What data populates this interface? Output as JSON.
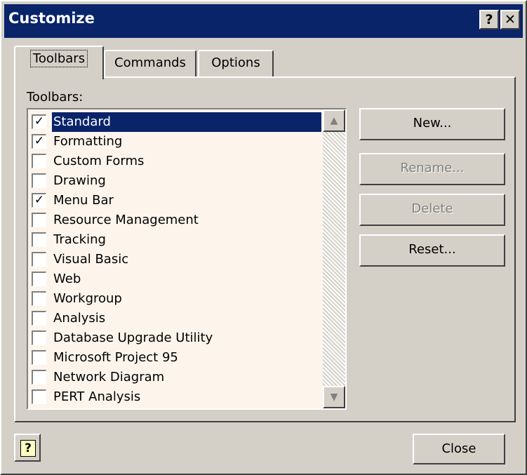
{
  "window": {
    "title": "Customize",
    "help_label": "?",
    "close_label": "✕"
  },
  "tabs": [
    {
      "label": "Toolbars",
      "active": true
    },
    {
      "label": "Commands",
      "active": false
    },
    {
      "label": "Options",
      "active": false
    }
  ],
  "toolbars_label": "Toolbars:",
  "toolbar_items": [
    {
      "label": "Standard",
      "checked": true,
      "selected": true
    },
    {
      "label": "Formatting",
      "checked": true,
      "selected": false
    },
    {
      "label": "Custom Forms",
      "checked": false,
      "selected": false
    },
    {
      "label": "Drawing",
      "checked": false,
      "selected": false
    },
    {
      "label": "Menu Bar",
      "checked": true,
      "selected": false
    },
    {
      "label": "Resource Management",
      "checked": false,
      "selected": false
    },
    {
      "label": "Tracking",
      "checked": false,
      "selected": false
    },
    {
      "label": "Visual Basic",
      "checked": false,
      "selected": false
    },
    {
      "label": "Web",
      "checked": false,
      "selected": false
    },
    {
      "label": "Workgroup",
      "checked": false,
      "selected": false
    },
    {
      "label": "Analysis",
      "checked": false,
      "selected": false
    },
    {
      "label": "Database Upgrade Utility",
      "checked": false,
      "selected": false
    },
    {
      "label": "Microsoft Project 95",
      "checked": false,
      "selected": false
    },
    {
      "label": "Network Diagram",
      "checked": false,
      "selected": false
    },
    {
      "label": "PERT Analysis",
      "checked": false,
      "selected": false
    }
  ],
  "buttons": {
    "new": {
      "label": "New...",
      "enabled": true
    },
    "rename": {
      "label": "Rename...",
      "enabled": false
    },
    "delete": {
      "label": "Delete",
      "enabled": false
    },
    "reset": {
      "label": "Reset...",
      "enabled": true
    },
    "close": {
      "label": "Close",
      "enabled": true
    }
  },
  "assistant_help_label": "?",
  "icons": {
    "help": "question-mark-icon",
    "close": "close-x-icon",
    "checkbox_checked": "checkmark-icon",
    "scroll_up": "triangle-up-icon",
    "scroll_down": "triangle-down-icon"
  },
  "colors": {
    "face": "#d4d0c8",
    "titlebar": "#0a246a",
    "selection": "#0a246a",
    "list_bg": "#fdf5ec"
  }
}
